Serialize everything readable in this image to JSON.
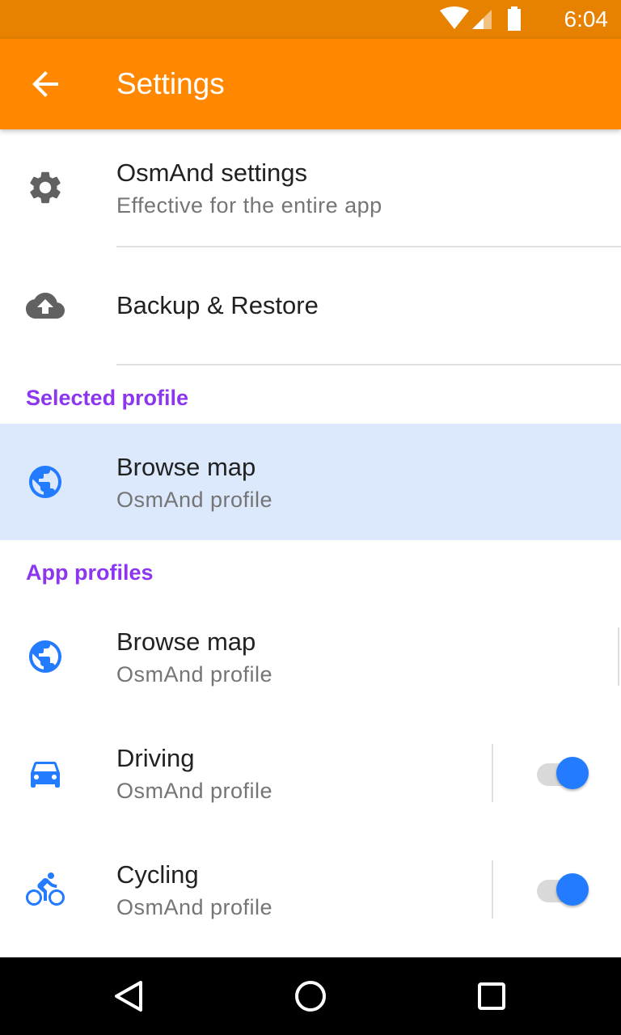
{
  "status_bar": {
    "time": "6:04",
    "icons": [
      "wifi-icon",
      "cellular-signal-icon",
      "battery-icon"
    ],
    "background": "#e68200"
  },
  "app_bar": {
    "title": "Settings",
    "back_icon": "arrow-back-icon",
    "background": "#ff8800"
  },
  "global_settings": [
    {
      "icon": "gear-icon",
      "title": "OsmAnd settings",
      "subtitle": "Effective for the entire app"
    },
    {
      "icon": "cloud-upload-icon",
      "title": "Backup & Restore"
    }
  ],
  "selected_profile": {
    "header": "Selected profile",
    "item": {
      "icon": "globe-icon",
      "title": "Browse map",
      "subtitle": "OsmAnd profile"
    }
  },
  "app_profiles": {
    "header": "App profiles",
    "items": [
      {
        "icon": "globe-icon",
        "title": "Browse map",
        "subtitle": "OsmAnd profile"
      },
      {
        "icon": "car-icon",
        "title": "Driving",
        "subtitle": "OsmAnd profile",
        "enabled": true
      },
      {
        "icon": "bicycle-icon",
        "title": "Cycling",
        "subtitle": "OsmAnd profile",
        "enabled": true
      }
    ]
  },
  "nav_bar": {
    "buttons": [
      "back-triangle-icon",
      "home-circle-icon",
      "recents-square-icon"
    ]
  },
  "colors": {
    "accent": "#8c37ef",
    "profile_icon": "#237bff",
    "selected_background": "#dce9fc"
  }
}
